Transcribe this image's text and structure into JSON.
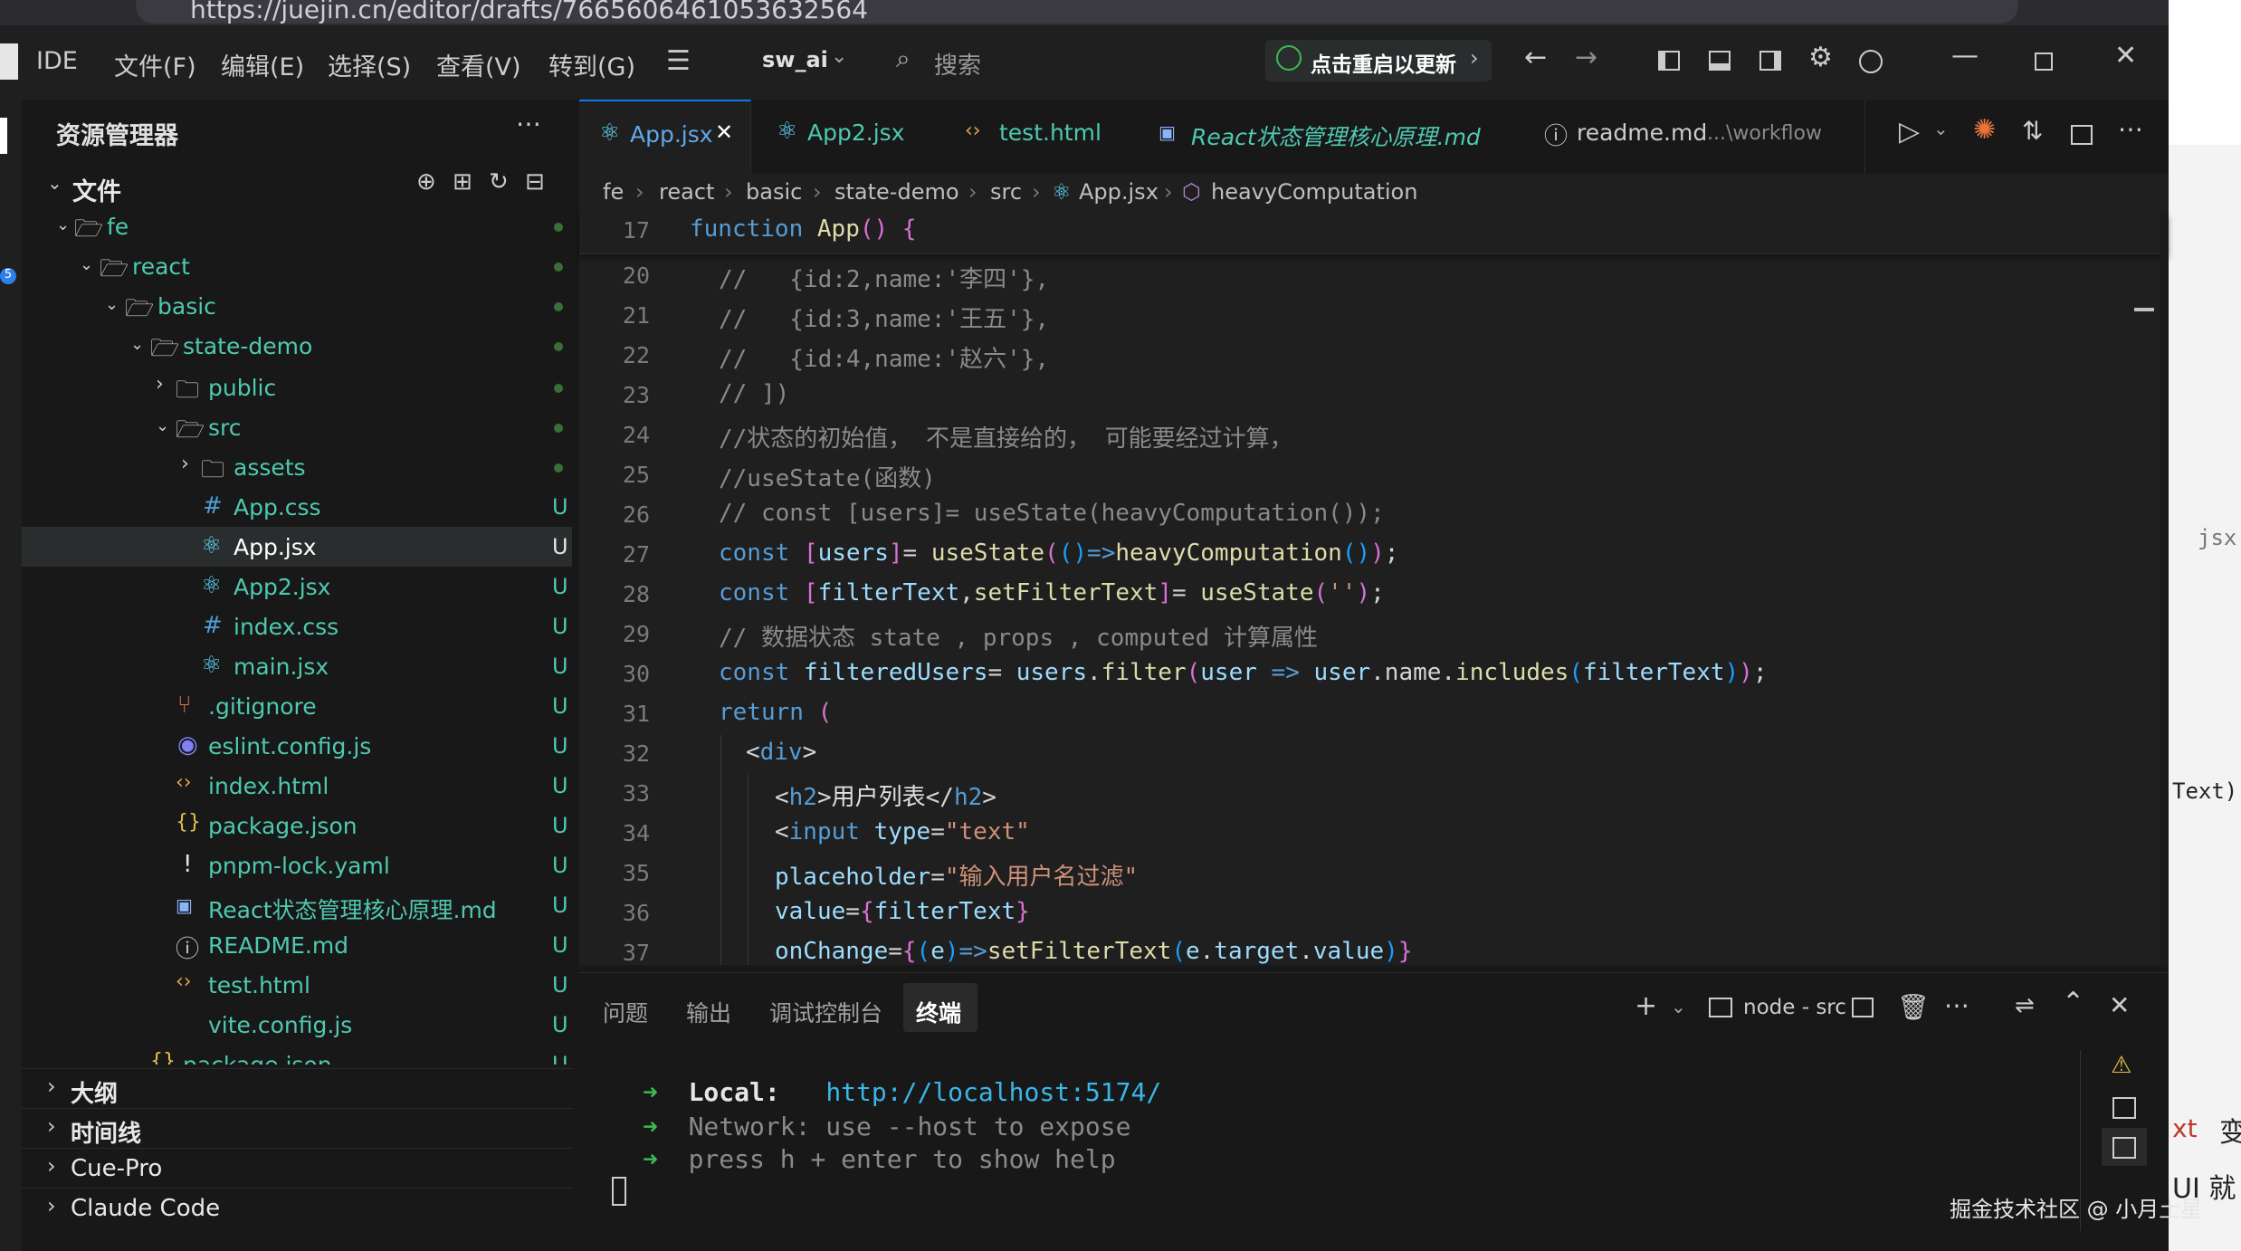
{
  "browser": {
    "url": "https://juejin.cn/editor/drafts/7665606461053632564"
  },
  "titlebar": {
    "ide_label": "IDE",
    "menus": [
      "文件(F)",
      "编辑(E)",
      "选择(S)",
      "查看(V)",
      "转到(G)"
    ],
    "profile": "sw_ai",
    "search_placeholder": "搜索",
    "update_label": "点击重启以更新"
  },
  "sidebar": {
    "title": "资源管理器",
    "section": "文件",
    "tree": [
      {
        "label": "fe",
        "kind": "folder"
      },
      {
        "label": "react",
        "kind": "folder"
      },
      {
        "label": "basic",
        "kind": "folder"
      },
      {
        "label": "state-demo",
        "kind": "folder"
      },
      {
        "label": "public",
        "kind": "folder"
      },
      {
        "label": "src",
        "kind": "folder"
      },
      {
        "label": "assets",
        "kind": "folder"
      },
      {
        "label": "App.css",
        "status": "U"
      },
      {
        "label": "App.jsx",
        "status": "U"
      },
      {
        "label": "App2.jsx",
        "status": "U"
      },
      {
        "label": "index.css",
        "status": "U"
      },
      {
        "label": "main.jsx",
        "status": "U"
      },
      {
        "label": ".gitignore",
        "status": "U"
      },
      {
        "label": "eslint.config.js",
        "status": "U"
      },
      {
        "label": "index.html",
        "status": "U"
      },
      {
        "label": "package.json",
        "status": "U"
      },
      {
        "label": "pnpm-lock.yaml",
        "status": "U"
      },
      {
        "label": "React状态管理核心原理.md",
        "status": "U"
      },
      {
        "label": "README.md",
        "status": "U"
      },
      {
        "label": "test.html",
        "status": "U"
      },
      {
        "label": "vite.config.js",
        "status": "U"
      },
      {
        "label": "package.json",
        "status": "U"
      }
    ],
    "bottom_sections": [
      "大纲",
      "时间线",
      "Cue-Pro",
      "Claude Code"
    ]
  },
  "tabs": [
    {
      "label": "App.jsx"
    },
    {
      "label": "App2.jsx"
    },
    {
      "label": "test.html"
    },
    {
      "label": "React状态管理核心原理.md"
    },
    {
      "label": "readme.md",
      "hint": "...\\workflow"
    }
  ],
  "breadcrumb": [
    "fe",
    "react",
    "basic",
    "state-demo",
    "src",
    "App.jsx",
    "heavyComputation"
  ],
  "editor": {
    "sticky_line": {
      "num": "17",
      "text": "function App() {"
    },
    "line_numbers": [
      "20",
      "21",
      "22",
      "23",
      "24",
      "25",
      "26",
      "27",
      "28",
      "29",
      "30",
      "31",
      "32",
      "33",
      "34",
      "35",
      "36",
      "37"
    ],
    "lines": [
      "//   {id:2,name:'李四'},",
      "//   {id:3,name:'王五'},",
      "//   {id:4,name:'赵六'},",
      "// ])",
      "//状态的初始值， 不是直接给的， 可能要经过计算，",
      "//useState(函数)",
      "// const [users]= useState(heavyComputation());",
      "const [users]= useState(()=>heavyComputation());",
      "const [filterText,setFilterText]= useState('');",
      "// 数据状态 state , props , computed 计算属性",
      "const filteredUsers= users.filter(user => user.name.includes(filterText));",
      "return (",
      "<div>",
      "<h2>用户列表</h2>",
      "<input type=\"text\"",
      "placeholder=\"输入用户名过滤\"",
      "value={filterText}",
      "onChange={(e)=>setFilterText(e.target.value)}"
    ]
  },
  "panel": {
    "tabs": [
      "问题",
      "输出",
      "调试控制台",
      "终端"
    ],
    "active_tab": "终端",
    "terminal_name": "node - src",
    "terminal": [
      {
        "arrow": "➜",
        "key": "Local:",
        "value": "http://localhost:5174/"
      },
      {
        "arrow": "➜",
        "key": "Network:",
        "value": "use --host to expose"
      },
      {
        "arrow": "➜",
        "key": "",
        "value": "press h + enter to show help"
      }
    ]
  },
  "watermark": "掘金技术社区 @ 小月土星",
  "page_bleed": [
    "jsx",
    "Text)",
    "xt",
    "变",
    "UI 就"
  ]
}
